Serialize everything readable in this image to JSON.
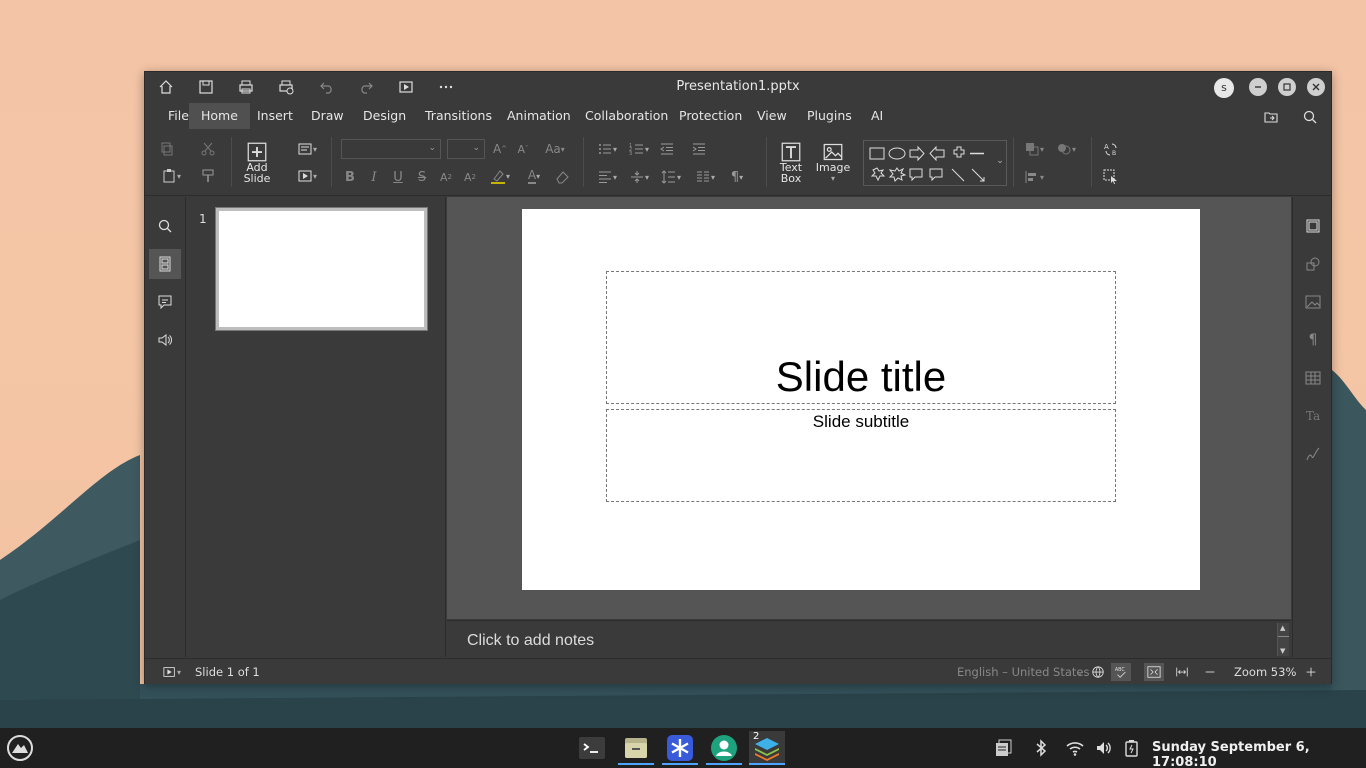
{
  "window": {
    "title": "Presentation1.pptx",
    "user_initial": "s"
  },
  "menu": {
    "items": [
      "File",
      "Home",
      "Insert",
      "Draw",
      "Design",
      "Transitions",
      "Animation",
      "Collaboration",
      "Protection",
      "View",
      "Plugins",
      "AI"
    ],
    "active": "Home"
  },
  "ribbon": {
    "add_slide_label_1": "Add",
    "add_slide_label_2": "Slide",
    "text_box_label_1": "Text",
    "text_box_label_2": "Box",
    "image_label": "Image",
    "font_name": "",
    "font_size": ""
  },
  "slides_panel": {
    "slide_number": "1"
  },
  "slide": {
    "title": "Slide title",
    "subtitle": "Slide subtitle"
  },
  "notes": {
    "placeholder": "Click to add notes"
  },
  "status": {
    "slide_counter": "Slide 1 of 1",
    "language": "English – United States",
    "zoom": "Zoom 53%"
  },
  "taskbar": {
    "badge_count": "2",
    "clock": "Sunday September 6, 17:08:10"
  },
  "colors": {
    "accent": "#4ea3ff",
    "window_bg": "#3a3a3a",
    "canvas_bg": "#555555"
  }
}
